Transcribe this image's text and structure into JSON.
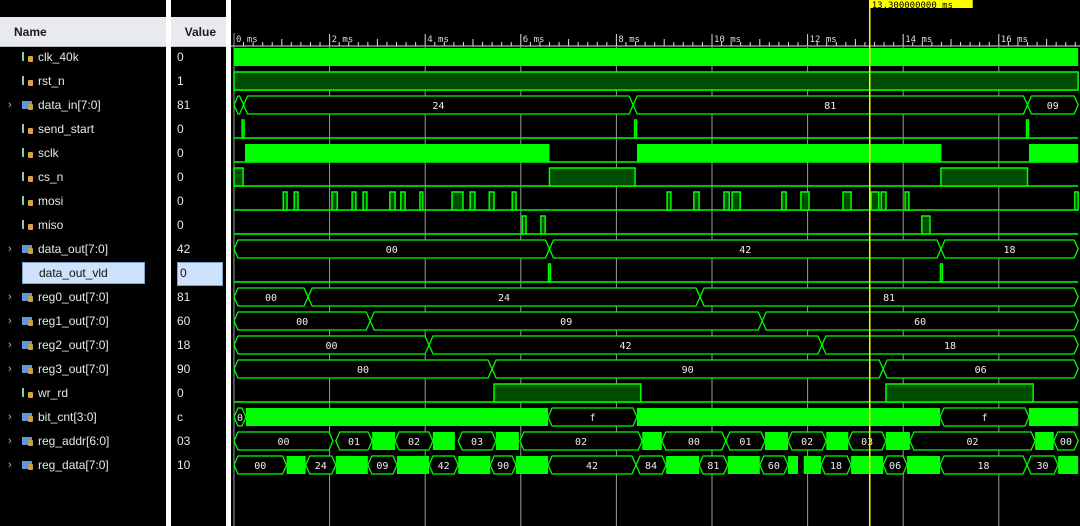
{
  "header": {
    "name_col": "Name",
    "value_col": "Value"
  },
  "cursor": {
    "time_ms": 13.3,
    "label": "13.300000000 ms",
    "color": "#ffff00"
  },
  "time_axis": {
    "unit": "ms",
    "start_ms": 0,
    "end_ms": 17.66,
    "labels": [
      "0 ms",
      "2 ms",
      "4 ms",
      "6 ms",
      "8 ms",
      "10 ms",
      "12 ms",
      "14 ms",
      "16 ms"
    ],
    "major_step_ms": 2
  },
  "colors": {
    "wave": "#00ff00",
    "wave_dark_fill": "#004d00",
    "grid": "#9a9a9a",
    "background": "#000000"
  },
  "selected_signal": "data_out_vld",
  "signals": [
    {
      "name": "clk_40k",
      "value": "0",
      "kind": "bit",
      "clock": true
    },
    {
      "name": "rst_n",
      "value": "1",
      "kind": "bit",
      "high": [
        [
          0,
          17.66
        ]
      ]
    },
    {
      "name": "data_in[7:0]",
      "value": "81",
      "kind": "bus",
      "segs": [
        [
          0,
          0.2,
          ""
        ],
        [
          0.2,
          8.35,
          "24"
        ],
        [
          8.35,
          16.6,
          "81"
        ],
        [
          16.6,
          17.66,
          "09"
        ]
      ]
    },
    {
      "name": "send_start",
      "value": "0",
      "kind": "bit",
      "high": [
        [
          0.17,
          0.21
        ],
        [
          8.38,
          8.42
        ],
        [
          16.58,
          16.62
        ]
      ]
    },
    {
      "name": "sclk",
      "value": "0",
      "kind": "bit",
      "dense": [
        [
          0.23,
          6.6
        ],
        [
          8.43,
          14.8
        ],
        [
          16.63,
          17.66
        ]
      ]
    },
    {
      "name": "cs_n",
      "value": "0",
      "kind": "bit",
      "high": [
        [
          0,
          0.19
        ],
        [
          6.6,
          8.39
        ],
        [
          14.79,
          16.6
        ]
      ]
    },
    {
      "name": "mosi",
      "value": "0",
      "kind": "bit",
      "high": [
        [
          1.03,
          1.11
        ],
        [
          1.26,
          1.34
        ],
        [
          2.05,
          2.16
        ],
        [
          2.47,
          2.55
        ],
        [
          2.7,
          2.78
        ],
        [
          3.26,
          3.37
        ],
        [
          3.49,
          3.58
        ],
        [
          3.89,
          3.95
        ],
        [
          4.56,
          4.79
        ],
        [
          4.94,
          5.04
        ],
        [
          5.34,
          5.44
        ],
        [
          5.82,
          5.9
        ],
        [
          9.06,
          9.14
        ],
        [
          9.62,
          9.73
        ],
        [
          10.25,
          10.36
        ],
        [
          10.42,
          10.59
        ],
        [
          11.46,
          11.55
        ],
        [
          11.86,
          12.03
        ],
        [
          12.74,
          12.91
        ],
        [
          13.33,
          13.49
        ],
        [
          13.54,
          13.64
        ],
        [
          14.04,
          14.12
        ],
        [
          17.59,
          17.66
        ]
      ]
    },
    {
      "name": "miso",
      "value": "0",
      "kind": "bit",
      "high": [
        [
          6.03,
          6.11
        ],
        [
          6.42,
          6.51
        ],
        [
          14.39,
          14.56
        ]
      ]
    },
    {
      "name": "data_out[7:0]",
      "value": "42",
      "kind": "bus",
      "segs": [
        [
          0,
          6.6,
          "00"
        ],
        [
          6.6,
          14.79,
          "42"
        ],
        [
          14.79,
          17.66,
          "18"
        ]
      ]
    },
    {
      "name": "data_out_vld",
      "value": "0",
      "kind": "bit",
      "high": [
        [
          6.58,
          6.62
        ],
        [
          14.78,
          14.82
        ]
      ]
    },
    {
      "name": "reg0_out[7:0]",
      "value": "81",
      "kind": "bus",
      "segs": [
        [
          0,
          1.55,
          "00"
        ],
        [
          1.55,
          9.75,
          "24"
        ],
        [
          9.75,
          17.66,
          "81"
        ]
      ]
    },
    {
      "name": "reg1_out[7:0]",
      "value": "60",
      "kind": "bus",
      "segs": [
        [
          0,
          2.85,
          "00"
        ],
        [
          2.85,
          11.05,
          "09"
        ],
        [
          11.05,
          17.66,
          "60"
        ]
      ]
    },
    {
      "name": "reg2_out[7:0]",
      "value": "18",
      "kind": "bus",
      "segs": [
        [
          0,
          4.08,
          "00"
        ],
        [
          4.08,
          12.3,
          "42"
        ],
        [
          12.3,
          17.66,
          "18"
        ]
      ]
    },
    {
      "name": "reg3_out[7:0]",
      "value": "90",
      "kind": "bus",
      "segs": [
        [
          0,
          5.4,
          "00"
        ],
        [
          5.4,
          13.58,
          "90"
        ],
        [
          13.58,
          17.66,
          "06"
        ]
      ]
    },
    {
      "name": "wr_rd",
      "value": "0",
      "kind": "bit",
      "high": [
        [
          5.44,
          8.51
        ],
        [
          13.64,
          16.72
        ]
      ]
    },
    {
      "name": "bit_cnt[3:0]",
      "value": "c",
      "kind": "bus",
      "segs": [
        [
          0,
          0.25,
          "0"
        ],
        [
          0.25,
          6.57,
          "*"
        ],
        [
          6.57,
          8.43,
          "f"
        ],
        [
          8.43,
          14.77,
          "*"
        ],
        [
          14.77,
          16.63,
          "f"
        ],
        [
          16.63,
          17.66,
          "*"
        ]
      ]
    },
    {
      "name": "reg_addr[6:0]",
      "value": "03",
      "kind": "bus",
      "segs": [
        [
          0,
          2.07,
          "00"
        ],
        [
          2.13,
          2.89,
          "01"
        ],
        [
          2.89,
          3.37,
          "*"
        ],
        [
          3.37,
          4.16,
          "02"
        ],
        [
          4.16,
          4.62,
          "*"
        ],
        [
          4.69,
          5.48,
          "03"
        ],
        [
          5.48,
          5.96,
          "*"
        ],
        [
          5.98,
          8.54,
          "02"
        ],
        [
          8.54,
          8.95,
          "*"
        ],
        [
          8.95,
          10.29,
          "00"
        ],
        [
          10.29,
          11.11,
          "01"
        ],
        [
          11.11,
          11.59,
          "*"
        ],
        [
          11.59,
          12.39,
          "02"
        ],
        [
          12.39,
          12.85,
          "*"
        ],
        [
          12.85,
          13.64,
          "03"
        ],
        [
          13.64,
          14.14,
          "*"
        ],
        [
          14.14,
          16.76,
          "02"
        ],
        [
          16.76,
          17.15,
          "*"
        ],
        [
          17.15,
          17.66,
          "00"
        ]
      ]
    },
    {
      "name": "reg_data[7:0]",
      "value": "10",
      "kind": "bus",
      "segs": [
        [
          0,
          1.1,
          "00"
        ],
        [
          1.1,
          1.5,
          "*"
        ],
        [
          1.5,
          2.13,
          "24"
        ],
        [
          2.13,
          2.8,
          "*"
        ],
        [
          2.8,
          3.41,
          "09"
        ],
        [
          3.41,
          4.08,
          "*"
        ],
        [
          4.08,
          4.69,
          "42"
        ],
        [
          4.69,
          5.36,
          "*"
        ],
        [
          5.36,
          5.9,
          "90"
        ],
        [
          5.9,
          6.57,
          "*"
        ],
        [
          6.57,
          8.41,
          "42"
        ],
        [
          8.41,
          9.04,
          "84"
        ],
        [
          9.04,
          9.73,
          "*"
        ],
        [
          9.73,
          10.33,
          "81"
        ],
        [
          10.33,
          11.0,
          "*"
        ],
        [
          11.0,
          11.59,
          "60"
        ],
        [
          11.59,
          11.8,
          "*"
        ],
        [
          11.92,
          12.28,
          "*"
        ],
        [
          12.28,
          12.91,
          "18"
        ],
        [
          12.91,
          13.58,
          "*"
        ],
        [
          13.58,
          14.08,
          "06"
        ],
        [
          14.08,
          14.77,
          "*"
        ],
        [
          14.77,
          16.59,
          "18"
        ],
        [
          16.59,
          17.24,
          "30"
        ],
        [
          17.24,
          17.66,
          "*"
        ]
      ]
    }
  ]
}
